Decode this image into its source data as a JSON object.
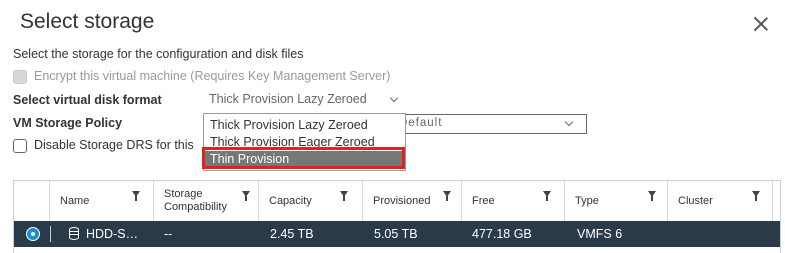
{
  "dialog": {
    "title": "Select storage",
    "description": "Select the storage for the configuration and disk files",
    "encrypt_label": "Encrypt this virtual machine (Requires Key Management Server)"
  },
  "disk_format": {
    "label": "Select virtual disk format",
    "selected": "Thick Provision Lazy Zeroed",
    "options": [
      "Thick Provision Lazy Zeroed",
      "Thick Provision Eager Zeroed",
      "Thin Provision"
    ],
    "highlighted": "Thin Provision"
  },
  "storage_policy": {
    "label": "VM Storage Policy",
    "value": "Default"
  },
  "drs": {
    "label": "Disable Storage DRS for this"
  },
  "table": {
    "columns": [
      {
        "label": "Name"
      },
      {
        "label": "Storage\nCompatibility"
      },
      {
        "label": "Capacity"
      },
      {
        "label": "Provisioned"
      },
      {
        "label": "Free"
      },
      {
        "label": "Type"
      },
      {
        "label": "Cluster"
      }
    ],
    "rows": [
      {
        "name": "HDD-S…",
        "compatibility": "--",
        "capacity": "2.45 TB",
        "provisioned": "5.05 TB",
        "free": "477.18 GB",
        "type": "VMFS 6",
        "cluster": ""
      }
    ]
  },
  "colors": {
    "selected_row": "#2b3a49",
    "highlight_border": "#e0231d",
    "dropdown_selected": "#777777",
    "radio": "#1d8fd1"
  }
}
